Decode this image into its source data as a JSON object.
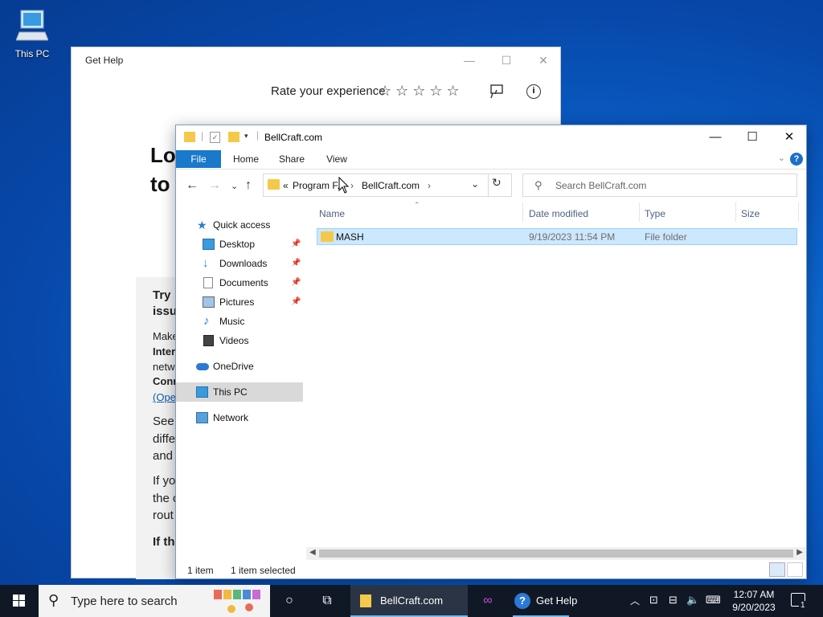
{
  "desktop": {
    "icons": [
      {
        "label": "This PC",
        "icon": "computer-icon"
      }
    ]
  },
  "gethelp": {
    "title": "Get Help",
    "rate_label": "Rate your experience",
    "stars": "☆☆☆☆☆",
    "heading": [
      "Lo",
      "to"
    ],
    "card_title": [
      "Try",
      "issu"
    ],
    "body": [
      "Make",
      "Inter",
      "netw",
      "Conn",
      "(Ope",
      "See",
      "diffe",
      "and",
      "If yo",
      "the c",
      "rout",
      "If th"
    ]
  },
  "explorer": {
    "title": "BellCraft.com",
    "ribbon_tabs": [
      "File",
      "Home",
      "Share",
      "View"
    ],
    "address": {
      "overflow": "«",
      "crumbs": [
        "Program F...",
        "BellCraft.com"
      ]
    },
    "search_placeholder": "Search BellCraft.com",
    "nav_pane": {
      "quick_access": "Quick access",
      "items": [
        {
          "label": "Desktop",
          "icon": "desktop-icon",
          "pinned": true
        },
        {
          "label": "Downloads",
          "icon": "download-icon",
          "pinned": true
        },
        {
          "label": "Documents",
          "icon": "documents-icon",
          "pinned": true
        },
        {
          "label": "Pictures",
          "icon": "pictures-icon",
          "pinned": true
        },
        {
          "label": "Music",
          "icon": "music-icon",
          "pinned": false
        },
        {
          "label": "Videos",
          "icon": "videos-icon",
          "pinned": false
        }
      ],
      "onedrive": "OneDrive",
      "this_pc": "This PC",
      "network": "Network"
    },
    "columns": [
      "Name",
      "Date modified",
      "Type",
      "Size"
    ],
    "rows": [
      {
        "name": "MASH",
        "date_modified": "9/19/2023 11:54 PM",
        "type": "File folder",
        "size": "",
        "selected": true
      }
    ],
    "status": {
      "count": "1 item",
      "selected": "1 item selected"
    }
  },
  "taskbar": {
    "search_placeholder": "Type here to search",
    "apps": [
      {
        "label": "BellCraft.com",
        "icon": "folder-icon",
        "active": true
      },
      {
        "label": "Get Help",
        "icon": "get-help-icon",
        "active": false
      }
    ],
    "clock": {
      "time": "12:07 AM",
      "date": "9/20/2023"
    },
    "notification_count": "1"
  },
  "colors": {
    "accent": "#1979ca",
    "selection": "#cce8ff",
    "folder": "#f4c94a",
    "taskbar": "#101826"
  }
}
